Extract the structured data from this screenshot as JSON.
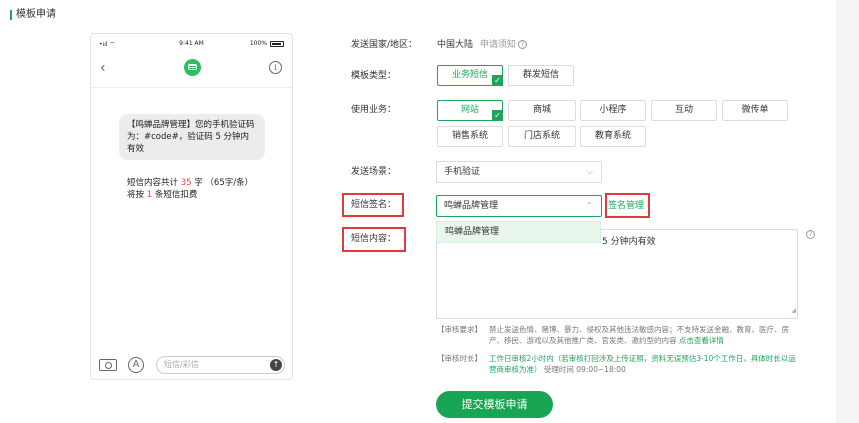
{
  "page": {
    "title": "模板申请"
  },
  "phone": {
    "status": {
      "signal": "•ııl ⌔",
      "time": "9:41 AM",
      "battery": "100%"
    },
    "back_icon": "‹",
    "info_icon": "i",
    "message": "【鸣蝉品牌管理】您的手机验证码为：#code#，验证码 5 分钟内有效",
    "count": {
      "prefix": "短信内容共计 ",
      "chars": "35",
      "middle": " 字 （65字/条）将按 ",
      "num": "1",
      "suffix": " 条短信扣费"
    },
    "input_placeholder": "短信/彩信",
    "send_icon": "↑",
    "appstore_icon": "A"
  },
  "form": {
    "country_label": "发送国家/地区：",
    "country_value": "中国大陆",
    "country_note": "申请须知",
    "type_label": "模板类型：",
    "type_options": [
      "业务短信",
      "群发短信"
    ],
    "usage_label": "使用业务：",
    "usage_options_row1": [
      "网站",
      "商城",
      "小程序",
      "互动",
      "微传单"
    ],
    "usage_options_row2": [
      "销售系统",
      "门店系统",
      "教育系统"
    ],
    "scene_label": "发送场景：",
    "scene_value": "手机验证",
    "sign_label": "短信签名：",
    "sign_value": "鸣蝉品牌管理",
    "sign_manage": "签名管理",
    "dropdown_option": "鸣蝉品牌管理",
    "content_label": "短信内容：",
    "content_value": "5 分钟内有效",
    "review_req_label": "【审核要求】",
    "review_req_text1": "禁止发送色情、赌博、暴力、侵权及其他违法敏感内容；不支持发送金融、教育、医疗、房",
    "review_req_text2": "产、移民、游戏以及其他推广类、官发类、邀约型的内容",
    "review_req_link": "点击查看详情",
    "review_time_label": "【审核时长】",
    "review_time_text1": "工作日审核2小时内（若审核打回涉及上传证照，资料无误预估3-10个工作日，具体时长以运",
    "review_time_text2": "营商审核为准）",
    "review_time_hours": "受理时间 09:00~18:00",
    "submit_label": "提交模板申请",
    "help_icon": "?"
  }
}
